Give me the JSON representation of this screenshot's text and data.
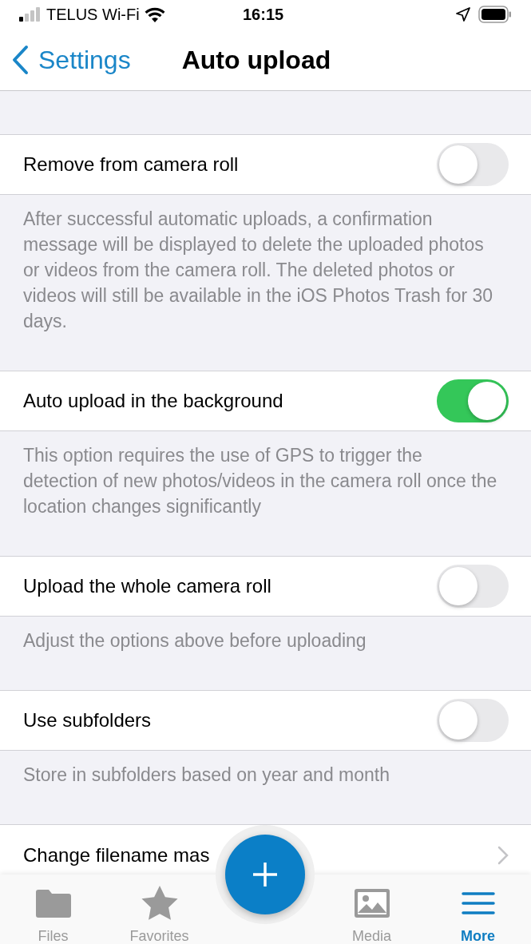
{
  "status_bar": {
    "carrier": "TELUS Wi-Fi",
    "time": "16:15"
  },
  "nav": {
    "back": "Settings",
    "title": "Auto upload"
  },
  "sections": [
    {
      "kind": "toggle",
      "label": "Remove from camera roll",
      "on": false,
      "description": "After successful automatic uploads, a confirmation message will be displayed to delete the uploaded photos or videos from the camera roll. The deleted photos or videos will still be available in the iOS Photos Trash for 30 days."
    },
    {
      "kind": "toggle",
      "label": "Auto upload in the background",
      "on": true,
      "description": "This option requires the use of GPS to trigger the detection of new photos/videos in the camera roll once the location changes significantly"
    },
    {
      "kind": "toggle",
      "label": "Upload the whole camera roll",
      "on": false,
      "description": "Adjust the options above before uploading"
    },
    {
      "kind": "toggle",
      "label": "Use subfolders",
      "on": false,
      "description": "Store in subfolders based on year and month"
    },
    {
      "kind": "link",
      "label": "Change filename mas"
    }
  ],
  "tabs": [
    {
      "kind": "files",
      "label": "Files",
      "selected": false
    },
    {
      "kind": "favorites",
      "label": "Favorites",
      "selected": false
    },
    {
      "kind": "fab"
    },
    {
      "kind": "media",
      "label": "Media",
      "selected": false
    },
    {
      "kind": "more",
      "label": "More",
      "selected": true
    }
  ]
}
